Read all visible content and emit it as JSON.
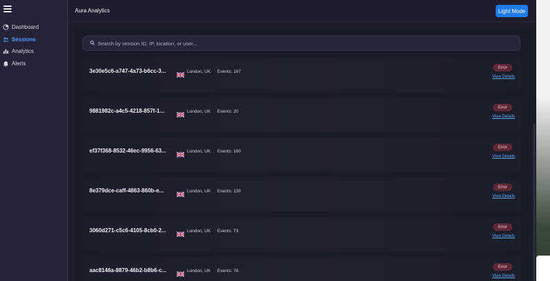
{
  "app": {
    "title": "Aura Analytics",
    "theme_button": "Light Mode"
  },
  "sidebar": {
    "items": [
      {
        "label": "Dashboard",
        "icon": "dashboard-icon",
        "active": false
      },
      {
        "label": "Sessions",
        "icon": "users-icon",
        "active": true
      },
      {
        "label": "Analytics",
        "icon": "bar-chart-icon",
        "active": false
      },
      {
        "label": "Alerts",
        "icon": "bell-icon",
        "active": false
      }
    ]
  },
  "search": {
    "placeholder": "Search by session ID, IP, location, or user..."
  },
  "sessions": [
    {
      "id": "3e30e5c6-a747-4a73-b6cc-3...",
      "location": "London, UK",
      "events": "Events: 167",
      "status": "Error",
      "link": "View Details"
    },
    {
      "id": "9881982c-a4c5-4218-857f-1...",
      "location": "London, UK",
      "events": "Events: 20",
      "status": "Error",
      "link": "View Details"
    },
    {
      "id": "ef37f368-8532-46ec-9956-63...",
      "location": "London, UK",
      "events": "Events: 160",
      "status": "Error",
      "link": "View Details"
    },
    {
      "id": "8e379dce-caff-4863-860b-e...",
      "location": "London, UK",
      "events": "Events: 130",
      "status": "Error",
      "link": "View Details"
    },
    {
      "id": "3060d271-c5c6-4105-8cb0-2...",
      "location": "London, UK",
      "events": "Events: 73",
      "status": "Error",
      "link": "View Details"
    },
    {
      "id": "aac8146a-8879-46b2-b8b6-c...",
      "location": "London, UK",
      "events": "Events: 78",
      "status": "Error",
      "link": "View Details"
    }
  ],
  "colors": {
    "accent": "#1f7aec",
    "error_badge": "#5e2934",
    "link": "#5aa7ff",
    "sidebar": "#262338"
  }
}
